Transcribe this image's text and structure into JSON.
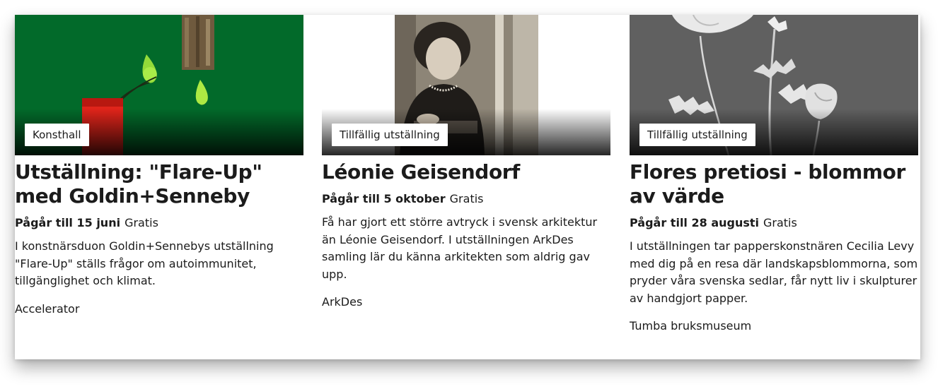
{
  "cards": [
    {
      "tag": "Konsthall",
      "title": "Utställning: \"Flare-Up\" med Goldin+Senneby",
      "until": "Pågår till 15 juni",
      "price": "Gratis",
      "description": "I konstnärsduon Goldin+Sennebys utställning \"Flare-Up\" ställs frågor om autoimmunitet, tillgänglighet och klimat.",
      "venue": "Accelerator",
      "image_bg": "#026a2a"
    },
    {
      "tag": "Tillfällig utställning",
      "title": "Léonie Geisendorf",
      "until": "Pågår till 5 oktober",
      "price": "Gratis",
      "description": "Få har gjort ett större avtryck i svensk arkitektur än Léonie Geisendorf. I utställningen ArkDes samling lär du känna arkitekten som aldrig gav upp.",
      "venue": "ArkDes",
      "image_bg": "#ffffff"
    },
    {
      "tag": "Tillfällig utställning",
      "title": "Flores pretiosi - blommor av värde",
      "until": "Pågår till 28 augusti",
      "price": "Gratis",
      "description": "I utställningen tar papperskonstnären Cecilia Levy med dig på en resa där landskapsblommorna, som pryder våra svenska sedlar, får nytt liv i skulpturer av handgjort papper.",
      "venue": "Tumba bruksmuseum",
      "image_bg": "#5a5a5a"
    }
  ]
}
